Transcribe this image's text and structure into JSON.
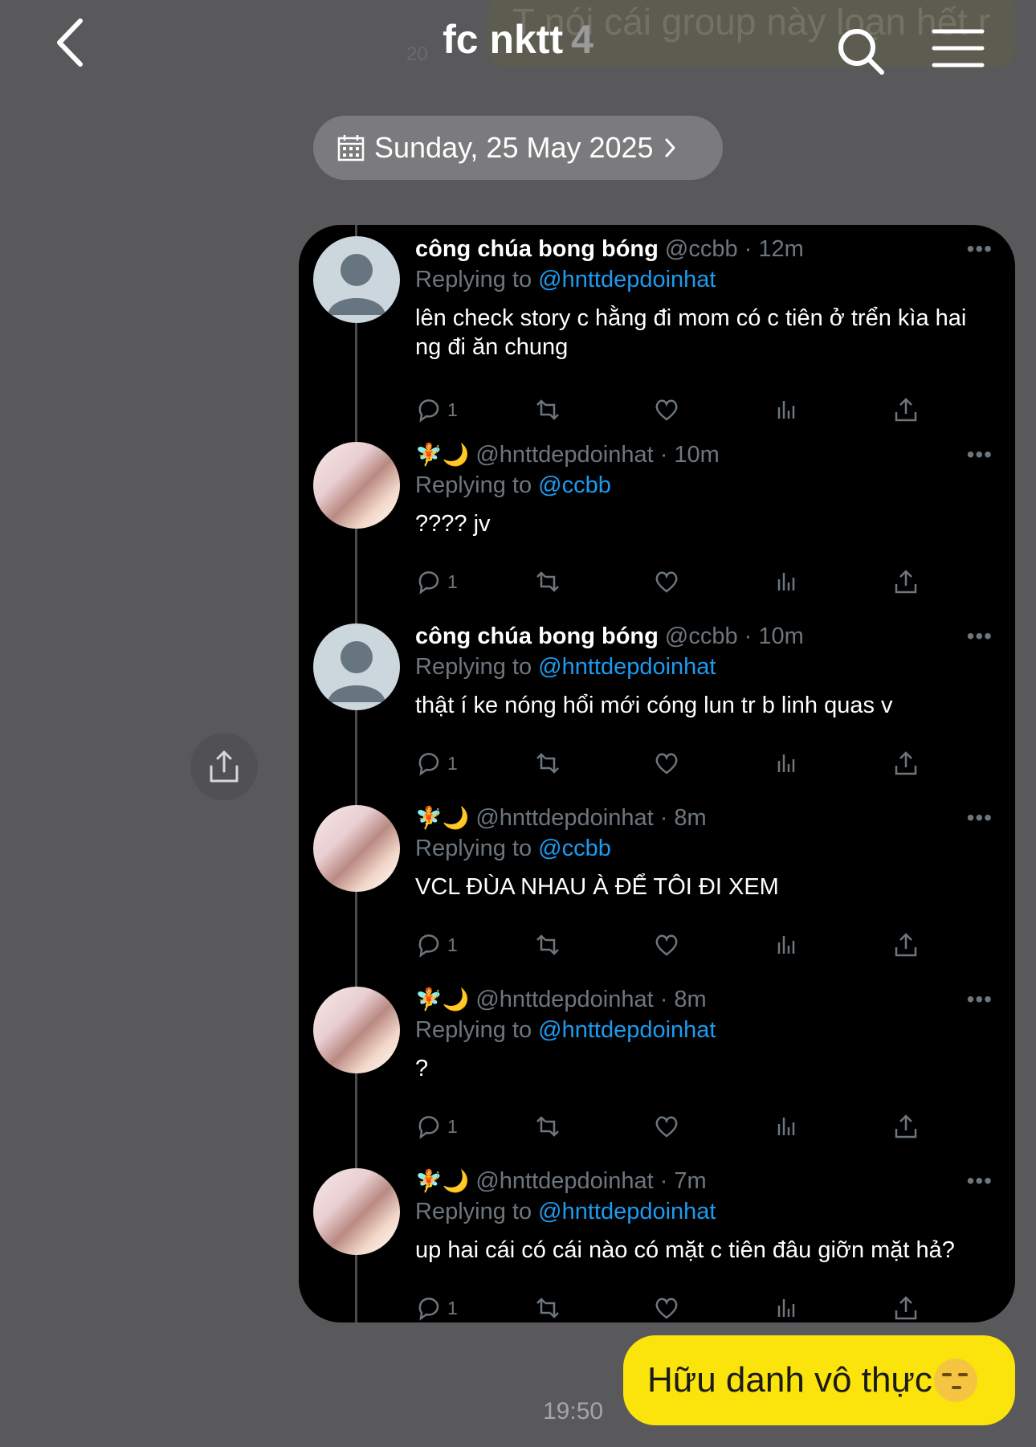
{
  "header": {
    "title": "fc nktt",
    "member_count": "4",
    "ghost_text": "T nói cái group này loạn hết r",
    "ghost_small": "20"
  },
  "date_pill": {
    "label": "Sunday, 25 May 2025"
  },
  "tweets": [
    {
      "name": "công chúa bong bóng",
      "handle": "@ccbb · 12m",
      "replying": "Replying to ",
      "mention": "@hnttdepdoinhat",
      "text": "lên check story c hằng đi mom có c tiên ở trển kìa hai ng đi ăn chung",
      "reply_count": "1",
      "avatar": "default"
    },
    {
      "name": "",
      "emoji": "🧚🌙",
      "handle": "@hnttdepdoinhat · 10m",
      "replying": "Replying to ",
      "mention": "@ccbb",
      "text": "???? jv",
      "reply_count": "1",
      "avatar": "photo"
    },
    {
      "name": "công chúa bong bóng",
      "handle": "@ccbb · 10m",
      "replying": "Replying to ",
      "mention": "@hnttdepdoinhat",
      "text": "thật í ke nóng hổi mới cóng lun tr b linh quas v",
      "reply_count": "1",
      "avatar": "default"
    },
    {
      "name": "",
      "emoji": "🧚🌙",
      "handle": "@hnttdepdoinhat · 8m",
      "replying": "Replying to ",
      "mention": "@ccbb",
      "text": "VCL ĐÙA NHAU À ĐỂ TÔI ĐI XEM",
      "reply_count": "1",
      "avatar": "photo"
    },
    {
      "name": "",
      "emoji": "🧚🌙",
      "handle": "@hnttdepdoinhat · 8m",
      "replying": "Replying to ",
      "mention": "@hnttdepdoinhat",
      "text": "?",
      "reply_count": "1",
      "avatar": "photo"
    },
    {
      "name": "",
      "emoji": "🧚🌙",
      "handle": "@hnttdepdoinhat · 7m",
      "replying": "Replying to ",
      "mention": "@hnttdepdoinhat",
      "text": "up hai cái có cái nào có mặt c tiên đâu giỡn mặt hả?",
      "reply_count": "1",
      "avatar": "photo"
    }
  ],
  "message": {
    "text": "Hữu danh vô thực",
    "emoji": "smirk-emoji",
    "time": "19:50"
  },
  "colors": {
    "background": "#59595b",
    "bubble": "#fbe30c",
    "mention": "#1d9bf0",
    "muted": "#6e767d"
  }
}
